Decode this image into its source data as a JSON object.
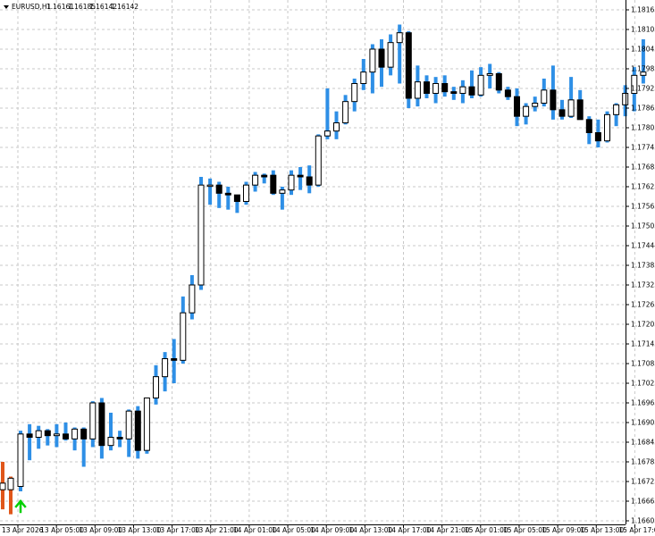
{
  "window": {
    "symbol_label": "EURUSD,H1",
    "ohlc_values": [
      "1.16161",
      "1.16185",
      "1.16142",
      "1.16142"
    ],
    "menu_icon": "triangle-down-icon"
  },
  "colors": {
    "background": "#ffffff",
    "grid": "#c8c8c8",
    "bull_outline": "#000000",
    "bull_fill": "#ffffff",
    "bear_fill": "#000000",
    "wick": "#2e8fe6",
    "history_bar": "#e0561a",
    "signal_arrow": "#00d000",
    "axis": "#000000"
  },
  "chart_data": {
    "type": "candlestick",
    "symbol": "EURUSD",
    "timeframe": "H1",
    "ylim": [
      1.16605,
      1.1819
    ],
    "yticks": [
      "1.18165",
      "1.18105",
      "1.18045",
      "1.17985",
      "1.17925",
      "1.17865",
      "1.17805",
      "1.17745",
      "1.17685",
      "1.17625",
      "1.17565",
      "1.17505",
      "1.17444",
      "1.17385",
      "1.17325",
      "1.17265",
      "1.17205",
      "1.17145",
      "1.17085",
      "1.17025",
      "1.16965",
      "1.16905",
      "1.16845",
      "1.16785",
      "1.16725",
      "1.16665",
      "1.16605"
    ],
    "xticks": [
      "13 Apr 2026",
      "13 Apr 05:00",
      "13 Apr 09:00",
      "13 Apr 13:00",
      "13 Apr 17:00",
      "13 Apr 21:00",
      "14 Apr 01:00",
      "14 Apr 05:00",
      "14 Apr 09:00",
      "14 Apr 13:00",
      "14 Apr 17:00",
      "14 Apr 21:00",
      "15 Apr 01:00",
      "15 Apr 05:00",
      "15 Apr 09:00",
      "15 Apr 13:00",
      "15 Apr 17:00"
    ],
    "grid": true,
    "candles": [
      {
        "o": 1.1671,
        "h": 1.1688,
        "l": 1.16695,
        "c": 1.1687
      },
      {
        "o": 1.1687,
        "h": 1.169,
        "l": 1.1679,
        "c": 1.1686
      },
      {
        "o": 1.1686,
        "h": 1.16895,
        "l": 1.16825,
        "c": 1.1688
      },
      {
        "o": 1.1688,
        "h": 1.16885,
        "l": 1.16835,
        "c": 1.16865
      },
      {
        "o": 1.16865,
        "h": 1.169,
        "l": 1.1683,
        "c": 1.1687
      },
      {
        "o": 1.1687,
        "h": 1.16905,
        "l": 1.1685,
        "c": 1.16855
      },
      {
        "o": 1.16855,
        "h": 1.1689,
        "l": 1.1682,
        "c": 1.16885
      },
      {
        "o": 1.16885,
        "h": 1.1689,
        "l": 1.1677,
        "c": 1.16855
      },
      {
        "o": 1.16855,
        "h": 1.1697,
        "l": 1.1683,
        "c": 1.16965
      },
      {
        "o": 1.16965,
        "h": 1.1698,
        "l": 1.16795,
        "c": 1.16835
      },
      {
        "o": 1.16835,
        "h": 1.16935,
        "l": 1.1682,
        "c": 1.1686
      },
      {
        "o": 1.1686,
        "h": 1.1688,
        "l": 1.1683,
        "c": 1.16855
      },
      {
        "o": 1.16855,
        "h": 1.16945,
        "l": 1.168,
        "c": 1.1694
      },
      {
        "o": 1.1694,
        "h": 1.16955,
        "l": 1.16795,
        "c": 1.1682
      },
      {
        "o": 1.1682,
        "h": 1.16975,
        "l": 1.1681,
        "c": 1.1698
      },
      {
        "o": 1.1698,
        "h": 1.1708,
        "l": 1.1696,
        "c": 1.17045
      },
      {
        "o": 1.17045,
        "h": 1.1712,
        "l": 1.17,
        "c": 1.171
      },
      {
        "o": 1.171,
        "h": 1.1716,
        "l": 1.17025,
        "c": 1.17095
      },
      {
        "o": 1.17095,
        "h": 1.1729,
        "l": 1.17085,
        "c": 1.1724
      },
      {
        "o": 1.1724,
        "h": 1.17355,
        "l": 1.1722,
        "c": 1.17325
      },
      {
        "o": 1.17325,
        "h": 1.17655,
        "l": 1.1731,
        "c": 1.1763
      },
      {
        "o": 1.1763,
        "h": 1.1765,
        "l": 1.1757,
        "c": 1.1763
      },
      {
        "o": 1.1763,
        "h": 1.1764,
        "l": 1.1756,
        "c": 1.17605
      },
      {
        "o": 1.17605,
        "h": 1.17625,
        "l": 1.17555,
        "c": 1.176
      },
      {
        "o": 1.176,
        "h": 1.17595,
        "l": 1.17545,
        "c": 1.1758
      },
      {
        "o": 1.1758,
        "h": 1.1764,
        "l": 1.1757,
        "c": 1.1763
      },
      {
        "o": 1.1763,
        "h": 1.1767,
        "l": 1.1761,
        "c": 1.1766
      },
      {
        "o": 1.1766,
        "h": 1.17665,
        "l": 1.17635,
        "c": 1.17655
      },
      {
        "o": 1.1766,
        "h": 1.17675,
        "l": 1.176,
        "c": 1.17605
      },
      {
        "o": 1.17605,
        "h": 1.17625,
        "l": 1.17555,
        "c": 1.17615
      },
      {
        "o": 1.17615,
        "h": 1.17675,
        "l": 1.176,
        "c": 1.1766
      },
      {
        "o": 1.1766,
        "h": 1.17685,
        "l": 1.17615,
        "c": 1.17655
      },
      {
        "o": 1.17655,
        "h": 1.1769,
        "l": 1.17605,
        "c": 1.1763
      },
      {
        "o": 1.1763,
        "h": 1.17785,
        "l": 1.17625,
        "c": 1.1778
      },
      {
        "o": 1.1778,
        "h": 1.17925,
        "l": 1.1777,
        "c": 1.17795
      },
      {
        "o": 1.17795,
        "h": 1.17855,
        "l": 1.1777,
        "c": 1.1782
      },
      {
        "o": 1.1782,
        "h": 1.17905,
        "l": 1.17815,
        "c": 1.17885
      },
      {
        "o": 1.17885,
        "h": 1.17955,
        "l": 1.17855,
        "c": 1.1794
      },
      {
        "o": 1.1794,
        "h": 1.18015,
        "l": 1.1792,
        "c": 1.17975
      },
      {
        "o": 1.17975,
        "h": 1.1806,
        "l": 1.1791,
        "c": 1.18045
      },
      {
        "o": 1.18045,
        "h": 1.18075,
        "l": 1.1793,
        "c": 1.1799
      },
      {
        "o": 1.1799,
        "h": 1.1809,
        "l": 1.17965,
        "c": 1.18065
      },
      {
        "o": 1.18065,
        "h": 1.1812,
        "l": 1.1794,
        "c": 1.18095
      },
      {
        "o": 1.18095,
        "h": 1.181,
        "l": 1.17865,
        "c": 1.17895
      },
      {
        "o": 1.17895,
        "h": 1.17995,
        "l": 1.1787,
        "c": 1.17945
      },
      {
        "o": 1.17945,
        "h": 1.17965,
        "l": 1.17895,
        "c": 1.1791
      },
      {
        "o": 1.1791,
        "h": 1.1796,
        "l": 1.1788,
        "c": 1.1794
      },
      {
        "o": 1.1794,
        "h": 1.17965,
        "l": 1.179,
        "c": 1.17915
      },
      {
        "o": 1.17915,
        "h": 1.1793,
        "l": 1.1789,
        "c": 1.1791
      },
      {
        "o": 1.1791,
        "h": 1.1795,
        "l": 1.1788,
        "c": 1.1793
      },
      {
        "o": 1.1793,
        "h": 1.1798,
        "l": 1.17895,
        "c": 1.17905
      },
      {
        "o": 1.17905,
        "h": 1.1799,
        "l": 1.179,
        "c": 1.17965
      },
      {
        "o": 1.17965,
        "h": 1.18,
        "l": 1.17925,
        "c": 1.1797
      },
      {
        "o": 1.1797,
        "h": 1.17975,
        "l": 1.1791,
        "c": 1.1792
      },
      {
        "o": 1.1792,
        "h": 1.1793,
        "l": 1.1789,
        "c": 1.179
      },
      {
        "o": 1.179,
        "h": 1.17925,
        "l": 1.1781,
        "c": 1.1784
      },
      {
        "o": 1.1784,
        "h": 1.1788,
        "l": 1.17815,
        "c": 1.1787
      },
      {
        "o": 1.1787,
        "h": 1.179,
        "l": 1.17855,
        "c": 1.1788
      },
      {
        "o": 1.1788,
        "h": 1.17955,
        "l": 1.1787,
        "c": 1.1792
      },
      {
        "o": 1.1792,
        "h": 1.17995,
        "l": 1.1783,
        "c": 1.1786
      },
      {
        "o": 1.1786,
        "h": 1.1789,
        "l": 1.1783,
        "c": 1.1784
      },
      {
        "o": 1.1784,
        "h": 1.1796,
        "l": 1.17835,
        "c": 1.1789
      },
      {
        "o": 1.1789,
        "h": 1.1792,
        "l": 1.1783,
        "c": 1.1783
      },
      {
        "o": 1.1783,
        "h": 1.1784,
        "l": 1.17755,
        "c": 1.1779
      },
      {
        "o": 1.1779,
        "h": 1.1783,
        "l": 1.17745,
        "c": 1.17765
      },
      {
        "o": 1.17765,
        "h": 1.17855,
        "l": 1.1776,
        "c": 1.17845
      },
      {
        "o": 1.17845,
        "h": 1.1788,
        "l": 1.1781,
        "c": 1.17875
      },
      {
        "o": 1.17875,
        "h": 1.17935,
        "l": 1.1784,
        "c": 1.1791
      },
      {
        "o": 1.1791,
        "h": 1.1799,
        "l": 1.17855,
        "c": 1.17965
      },
      {
        "o": 1.17965,
        "h": 1.18075,
        "l": 1.1794,
        "c": 1.17975
      }
    ],
    "history_bars": [
      {
        "o": 1.1672,
        "h": 1.16785,
        "l": 1.1664,
        "c": 1.167
      },
      {
        "o": 1.167,
        "h": 1.1674,
        "l": 1.16625,
        "c": 1.16735
      }
    ],
    "signals": [
      {
        "type": "buy-arrow",
        "index": 0
      }
    ]
  }
}
